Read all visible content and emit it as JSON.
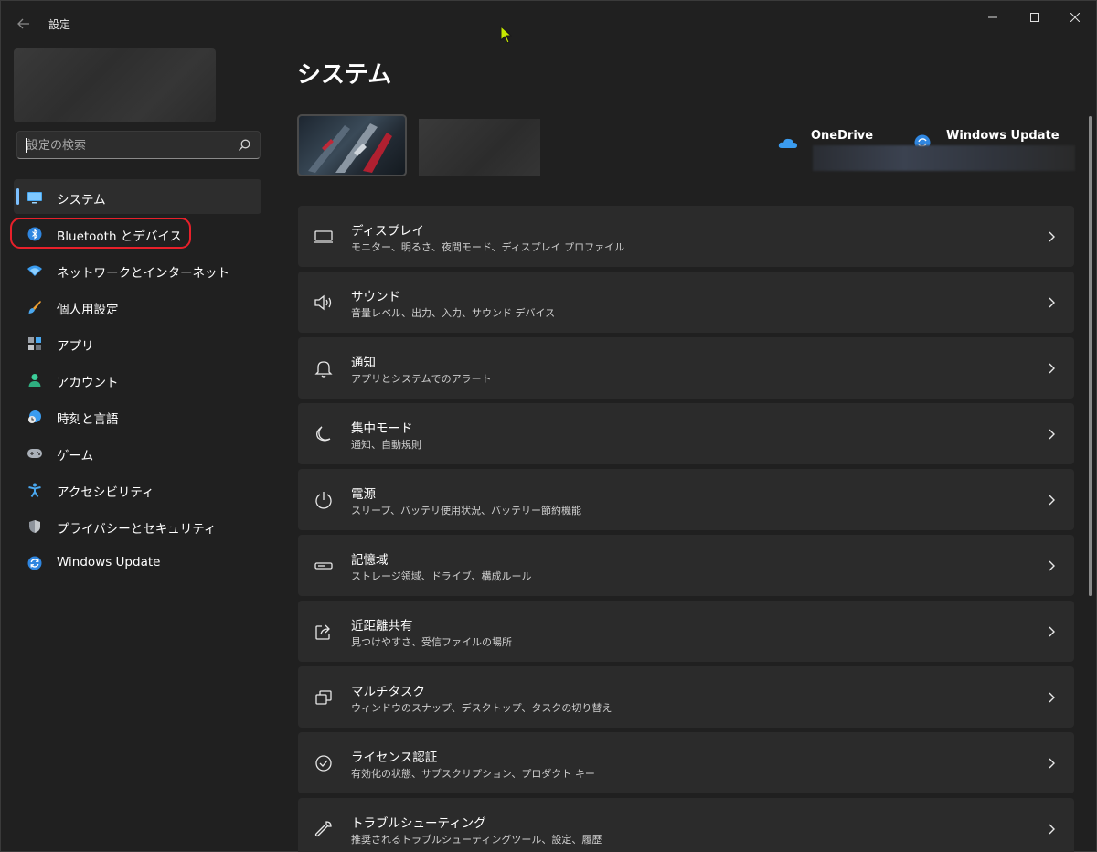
{
  "window": {
    "title": "設定",
    "back_icon": "back-arrow-icon",
    "controls": [
      "minimize-icon",
      "maximize-icon",
      "close-icon"
    ]
  },
  "sidebar": {
    "search": {
      "placeholder": "設定の検索",
      "value": ""
    },
    "items": [
      {
        "label": "システム",
        "icon": "display-icon",
        "selected": true
      },
      {
        "label": "Bluetooth とデバイス",
        "icon": "bluetooth-icon",
        "highlighted": true
      },
      {
        "label": "ネットワークとインターネット",
        "icon": "wifi-icon"
      },
      {
        "label": "個人用設定",
        "icon": "paintbrush-icon"
      },
      {
        "label": "アプリ",
        "icon": "apps-icon"
      },
      {
        "label": "アカウント",
        "icon": "person-icon"
      },
      {
        "label": "時刻と言語",
        "icon": "globe-clock-icon"
      },
      {
        "label": "ゲーム",
        "icon": "gamepad-icon"
      },
      {
        "label": "アクセシビリティ",
        "icon": "accessibility-icon"
      },
      {
        "label": "プライバシーとセキュリティ",
        "icon": "shield-icon"
      },
      {
        "label": "Windows Update",
        "icon": "windows-update-icon"
      }
    ]
  },
  "main": {
    "title": "システム",
    "quick_links": [
      {
        "label": "OneDrive",
        "icon": "onedrive-icon"
      },
      {
        "label": "Windows Update",
        "icon": "windows-update-icon"
      }
    ],
    "cards": [
      {
        "title": "ディスプレイ",
        "subtitle": "モニター、明るさ、夜間モード、ディスプレイ プロファイル",
        "icon": "monitor-icon"
      },
      {
        "title": "サウンド",
        "subtitle": "音量レベル、出力、入力、サウンド デバイス",
        "icon": "speaker-icon"
      },
      {
        "title": "通知",
        "subtitle": "アプリとシステムでのアラート",
        "icon": "bell-icon"
      },
      {
        "title": "集中モード",
        "subtitle": "通知、自動規則",
        "icon": "moon-icon"
      },
      {
        "title": "電源",
        "subtitle": "スリープ、バッテリ使用状況、バッテリー節約機能",
        "icon": "power-icon"
      },
      {
        "title": "記憶域",
        "subtitle": "ストレージ領域、ドライブ、構成ルール",
        "icon": "storage-icon"
      },
      {
        "title": "近距離共有",
        "subtitle": "見つけやすさ、受信ファイルの場所",
        "icon": "share-icon"
      },
      {
        "title": "マルチタスク",
        "subtitle": "ウィンドウのスナップ、デスクトップ、タスクの切り替え",
        "icon": "multitask-icon"
      },
      {
        "title": "ライセンス認証",
        "subtitle": "有効化の状態、サブスクリプション、プロダクト キー",
        "icon": "check-circle-icon"
      },
      {
        "title": "トラブルシューティング",
        "subtitle": "推奨されるトラブルシューティングツール、設定、履歴",
        "icon": "wrench-icon"
      }
    ]
  },
  "colors": {
    "background": "#202020",
    "card": "#2b2b2b",
    "accent": "#7cc0ff",
    "highlight_ring": "#e8202a"
  }
}
